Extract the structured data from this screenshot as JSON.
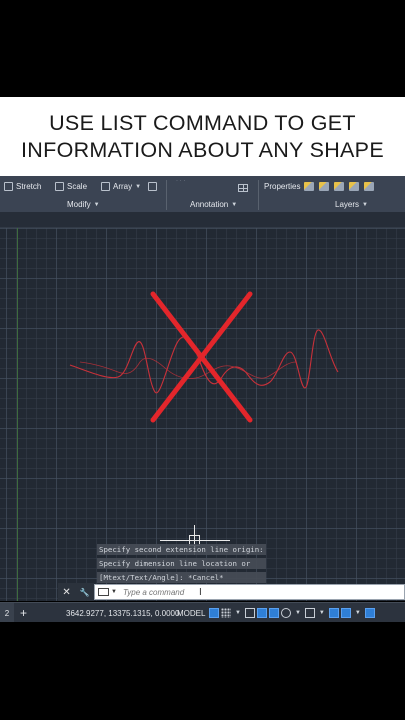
{
  "caption": {
    "line1": "USE LIST COMMAND TO GET",
    "line2": "INFORMATION ABOUT ANY SHAPE"
  },
  "ribbon": {
    "modify": {
      "stretch": "Stretch",
      "scale": "Scale",
      "array": "Array",
      "panel_label": "Modify"
    },
    "annotation": {
      "panel_label": "Annotation"
    },
    "layers": {
      "properties": "Properties",
      "panel_label": "Layers"
    }
  },
  "drawing": {
    "wave_color": "#c8313a",
    "cross_color": "#e3262b"
  },
  "command_history": [
    "Specify second extension line origin:",
    "Specify dimension line location or",
    "[Mtext/Text/Angle]: *Cancel*"
  ],
  "command_line": {
    "placeholder": "Type a command",
    "close_glyph": "✕",
    "tool_glyph": "🔧"
  },
  "status_bar": {
    "tab_label": "2",
    "add_label": "+",
    "coordinates": "3642.9277, 13375.1315, 0.0000",
    "model": "MODEL"
  },
  "icons": {
    "stretch": "stretch-icon",
    "scale": "scale-icon",
    "array": "array-icon",
    "layer": "layer-icon",
    "grid": "grid-icon",
    "snap": "snap-icon",
    "menu": "hamburger-icon"
  }
}
